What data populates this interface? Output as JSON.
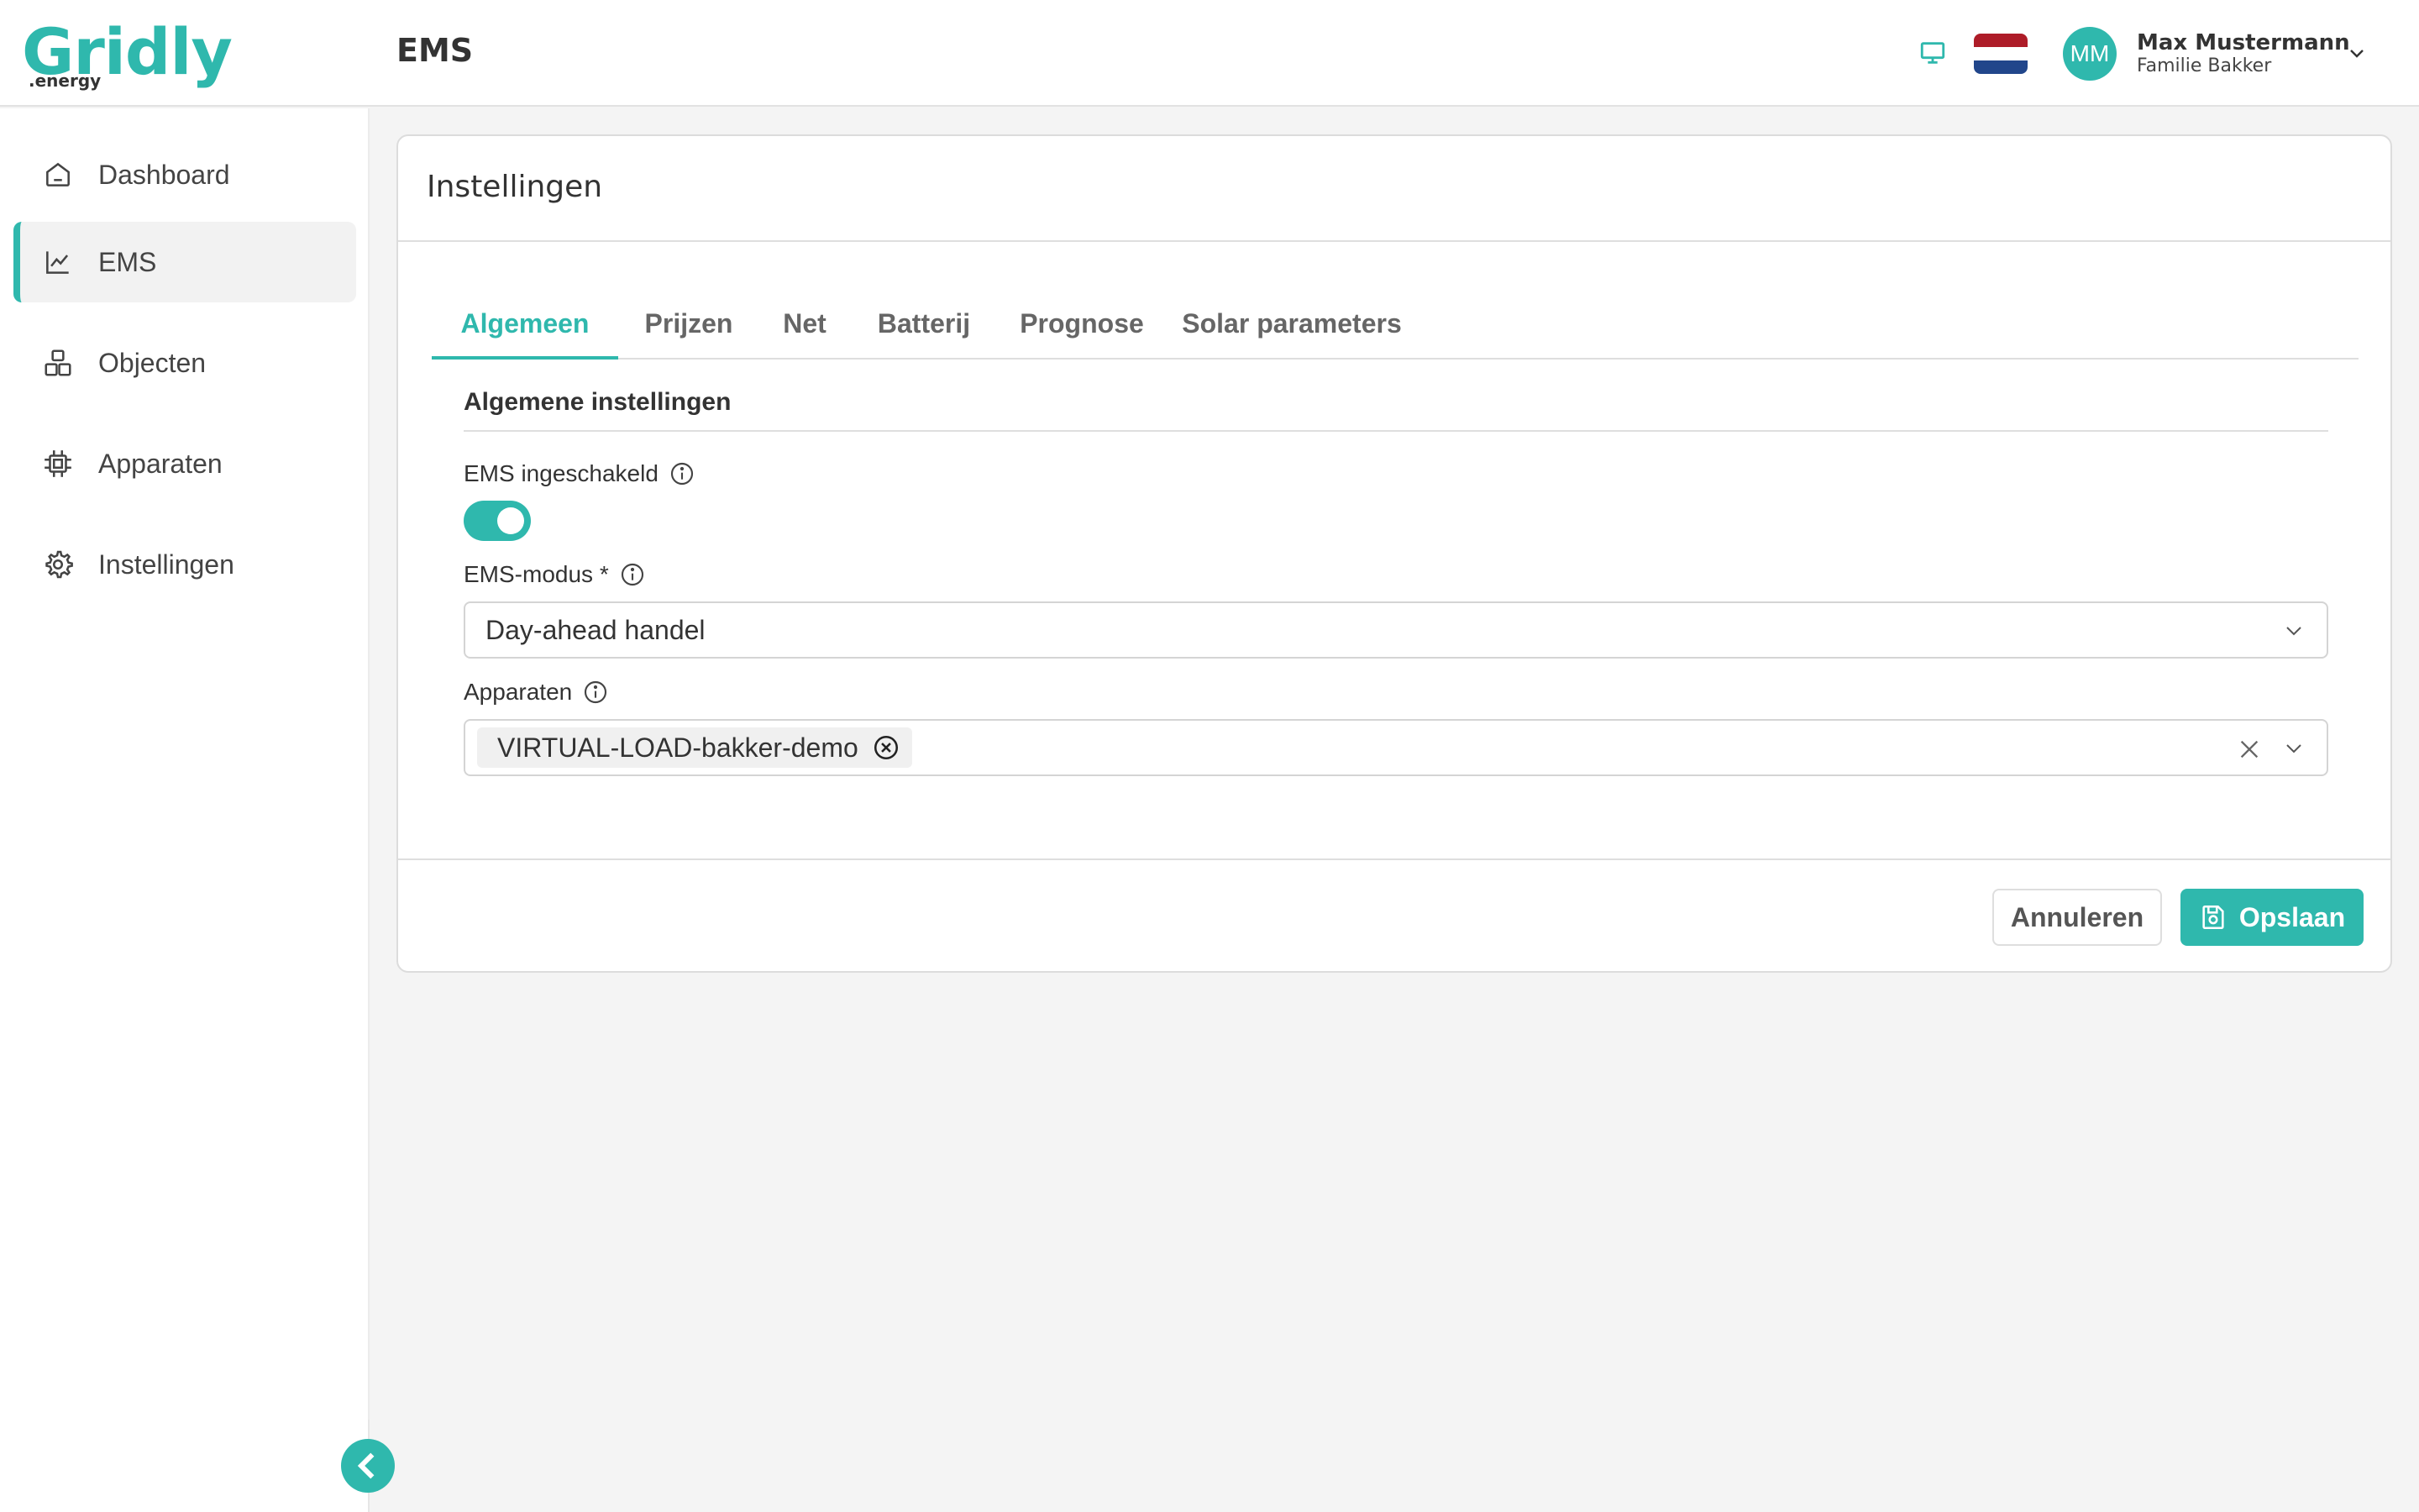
{
  "header": {
    "logo_main": "Gridly",
    "logo_sub": ".energy",
    "title": "EMS",
    "avatar_initials": "MM",
    "user_name": "Max Mustermann",
    "user_subtitle": "Familie Bakker",
    "monitor_icon": "monitor-icon",
    "language_flag": "netherlands-flag"
  },
  "sidebar": {
    "items": [
      {
        "label": "Dashboard",
        "icon": "home-icon",
        "active": false
      },
      {
        "label": "EMS",
        "icon": "chart-line-icon",
        "active": true
      },
      {
        "label": "Objecten",
        "icon": "objects-icon",
        "active": false
      },
      {
        "label": "Apparaten",
        "icon": "chip-icon",
        "active": false
      },
      {
        "label": "Instellingen",
        "icon": "gear-icon",
        "active": false
      }
    ],
    "collapse_icon": "chevron-left-icon"
  },
  "card": {
    "title": "Instellingen",
    "tabs": [
      {
        "label": "Algemeen",
        "active": true
      },
      {
        "label": "Prijzen",
        "active": false
      },
      {
        "label": "Net",
        "active": false
      },
      {
        "label": "Batterij",
        "active": false
      },
      {
        "label": "Prognose",
        "active": false
      },
      {
        "label": "Solar parameters",
        "active": false
      }
    ],
    "section_title": "Algemene instellingen",
    "ems_enabled": {
      "label": "EMS ingeschakeld",
      "value": true
    },
    "ems_mode": {
      "label": "EMS-modus *",
      "value": "Day-ahead handel"
    },
    "devices": {
      "label": "Apparaten",
      "selected": [
        "VIRTUAL-LOAD-bakker-demo"
      ]
    },
    "cancel_label": "Annuleren",
    "save_label": "Opslaan"
  },
  "colors": {
    "accent": "#2fb8ad",
    "text": "#333333",
    "background": "#f4f4f4"
  }
}
